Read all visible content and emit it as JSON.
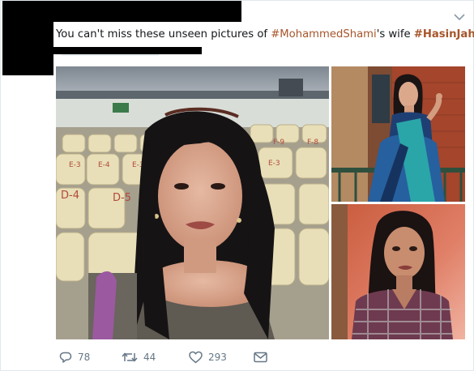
{
  "tweet": {
    "text_prefix": "You can't miss these unseen pictures of ",
    "hashtag1": "#MohammedShami",
    "text_middle": "'s wife ",
    "hashtag2": "#HasinJahan"
  },
  "media": {
    "photo_main_seat_labels": [
      "D-4",
      "D-5",
      "E-3",
      "E-4",
      "E-3",
      "E-3",
      "F-9",
      "F-8"
    ]
  },
  "actions": {
    "reply_count": "78",
    "retweet_count": "44",
    "like_count": "293"
  },
  "colors": {
    "hashtag": "#a7552a",
    "action_icon": "#657786",
    "border": "#e1e8ed"
  },
  "icons": [
    "chevron-down-icon",
    "reply-icon",
    "retweet-icon",
    "like-icon",
    "direct-message-icon"
  ]
}
